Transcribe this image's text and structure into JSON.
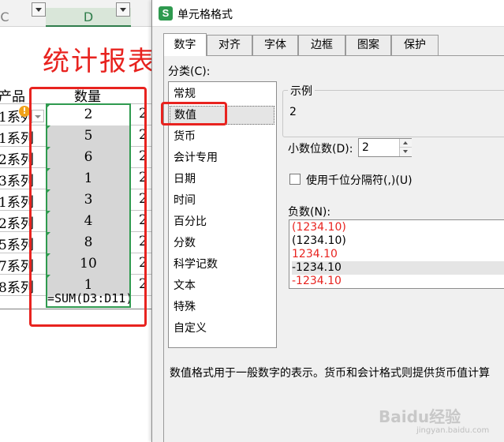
{
  "sheet": {
    "col_c": "C",
    "col_d": "D",
    "title": "统计报表",
    "header_left": "产品",
    "header_qty": "数量",
    "rows": [
      {
        "left": "1系列",
        "qty": "2",
        "next": "2"
      },
      {
        "left": "1系列",
        "qty": "5",
        "next": "2"
      },
      {
        "left": "2系列",
        "qty": "6",
        "next": "2"
      },
      {
        "left": "3系列",
        "qty": "1",
        "next": "2"
      },
      {
        "left": "1系列",
        "qty": "3",
        "next": "2"
      },
      {
        "left": "2系列",
        "qty": "4",
        "next": "2"
      },
      {
        "left": "5系列",
        "qty": "8",
        "next": "2"
      },
      {
        "left": "7系列",
        "qty": "10",
        "next": "2"
      },
      {
        "left": "8系列",
        "qty": "1",
        "next": "2"
      }
    ],
    "formula": "=SUM(D3:D11)",
    "warning_glyph": "!"
  },
  "dialog": {
    "title": "单元格格式",
    "icon_letter": "S",
    "tabs": [
      "数字",
      "对齐",
      "字体",
      "边框",
      "图案",
      "保护"
    ],
    "active_tab": "数字",
    "category_label": "分类(C):",
    "categories": [
      "常规",
      "数值",
      "货币",
      "会计专用",
      "日期",
      "时间",
      "百分比",
      "分数",
      "科学记数",
      "文本",
      "特殊",
      "自定义"
    ],
    "selected_category": "数值",
    "sample_label": "示例",
    "sample_value": "2",
    "decimal_label": "小数位数(D):",
    "decimal_value": "2",
    "thousands_label": "使用千位分隔符(,)(U)",
    "negative_label": "负数(N):",
    "negatives": [
      {
        "text": "(1234.10)",
        "color": "#e8231f"
      },
      {
        "text": "(1234.10)",
        "color": "#000000"
      },
      {
        "text": "1234.10",
        "color": "#e8231f"
      },
      {
        "text": "-1234.10",
        "color": "#000000"
      },
      {
        "text": "-1234.10",
        "color": "#e8231f"
      }
    ],
    "selected_negative_index": 3,
    "description": "数值格式用于一般数字的表示。货币和会计格式则提供货币值计算"
  },
  "watermark": {
    "main": "Baidu经验",
    "sub": "jingyan.baidu.com"
  },
  "colors": {
    "accent_red": "#e8231f",
    "selection_green": "#2f9a4f",
    "dialog_bg": "#f0f0f0"
  }
}
